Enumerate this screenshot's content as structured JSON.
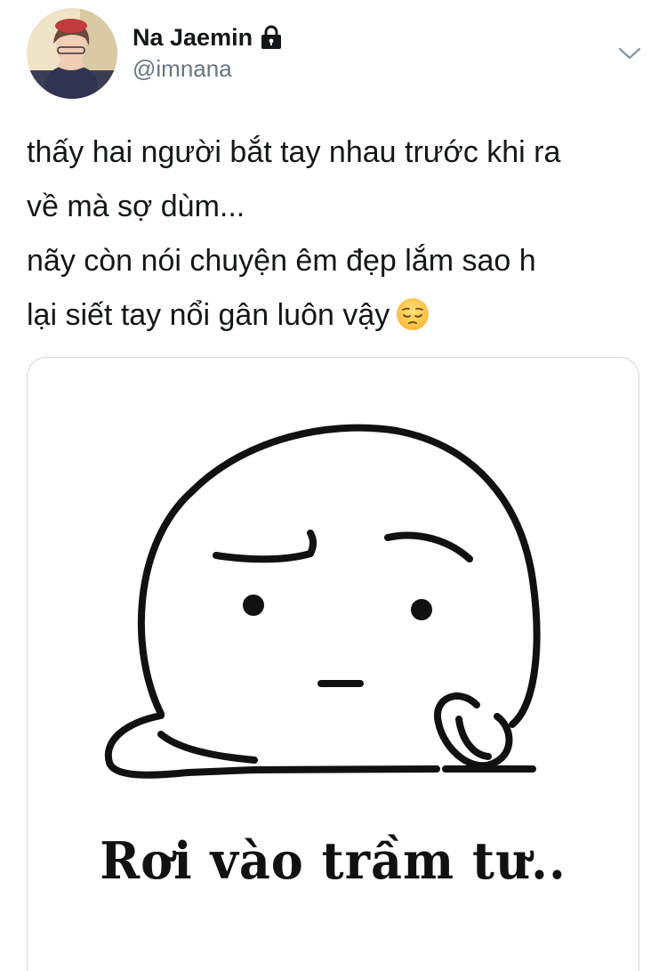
{
  "tweet": {
    "author": {
      "display_name": "Na Jaemin",
      "handle": "@imnana",
      "protected_icon": "lock-icon",
      "avatar": "avatar"
    },
    "menu_icon": "chevron-down-icon",
    "text_lines": [
      "thấy hai người bắt tay nhau trước khi ra",
      "về mà sợ dùm...",
      "nãy còn nói chuyện êm đẹp lắm sao h",
      "lại siết tay nổi gân luôn vậy"
    ],
    "emoji": "pensive-face-icon",
    "media": {
      "caption": "Rơi vào trầm tư..",
      "illustration": "pensive-blob-character"
    }
  }
}
